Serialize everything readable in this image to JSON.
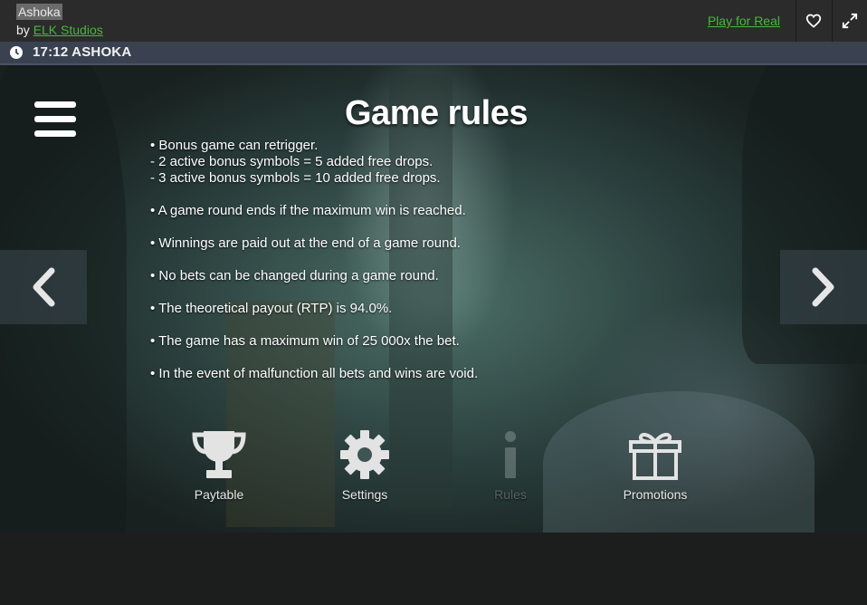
{
  "header": {
    "game_title": "Ashoka",
    "by_prefix": "by",
    "studio": "ELK Studios",
    "play_for_real": "Play for Real"
  },
  "status": {
    "text": "17:12 ASHOKA"
  },
  "rules": {
    "title": "Game rules",
    "lines": [
      "• Bonus game can retrigger.",
      "- 2 active bonus symbols = 5 added free drops.",
      "- 3 active bonus symbols = 10 added free drops.",
      "• A game round ends if the maximum win is reached.",
      "• Winnings are paid out at the end of a game round.",
      "• No bets can be changed during a game round.",
      "• The theoretical payout (RTP) is 94.0%.",
      "• The game has a maximum win of 25 000x the bet.",
      "• In the event of malfunction all bets and wins are void."
    ]
  },
  "tabs": {
    "paytable": "Paytable",
    "settings": "Settings",
    "rules": "Rules",
    "promotions": "Promotions"
  },
  "icons": {
    "menu": "hamburger-icon",
    "prev": "chevron-left-icon",
    "next": "chevron-right-icon",
    "favorite": "heart-icon",
    "fullscreen": "expand-icon",
    "clock": "clock-icon",
    "paytable": "trophy-icon",
    "settings": "gear-icon",
    "rules": "info-icon",
    "promotions": "gift-icon"
  },
  "colors": {
    "link_green": "#46b83c",
    "header_bg": "#2b2b2b",
    "status_bg": "#3a4150"
  }
}
